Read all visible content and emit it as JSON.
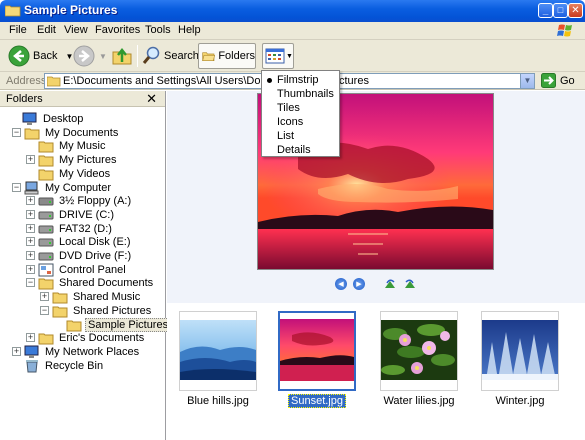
{
  "window": {
    "title": "Sample Pictures",
    "minimize": "_",
    "maximize": "□",
    "close": "✕"
  },
  "menu": [
    "File",
    "Edit",
    "View",
    "Favorites",
    "Tools",
    "Help"
  ],
  "toolbar": {
    "back": "Back",
    "search": "Search",
    "folders": "Folders"
  },
  "address": {
    "label": "Address",
    "path": "E:\\Documents and Settings\\All Users\\Documents\\My",
    "path_tail": "ctures",
    "go": "Go"
  },
  "views_menu": {
    "items": [
      "Filmstrip",
      "Thumbnails",
      "Tiles",
      "Icons",
      "List",
      "Details"
    ],
    "selected": "Filmstrip"
  },
  "folders_pane": {
    "title": "Folders",
    "close": "✕",
    "tree": [
      {
        "label": "Desktop",
        "icon": "desktop-icon",
        "toggle": ""
      },
      {
        "label": "My Documents",
        "icon": "my-documents-icon",
        "toggle": "−"
      },
      {
        "label": "My Music",
        "icon": "music-folder-icon",
        "toggle": ""
      },
      {
        "label": "My Pictures",
        "icon": "pictures-folder-icon",
        "toggle": "+"
      },
      {
        "label": "My Videos",
        "icon": "videos-folder-icon",
        "toggle": ""
      },
      {
        "label": "My Computer",
        "icon": "my-computer-icon",
        "toggle": "−"
      },
      {
        "label": "3½ Floppy (A:)",
        "icon": "floppy-icon",
        "toggle": "+"
      },
      {
        "label": "DRIVE (C:)",
        "icon": "drive-icon",
        "toggle": "+"
      },
      {
        "label": "FAT32 (D:)",
        "icon": "drive-icon",
        "toggle": "+"
      },
      {
        "label": "Local Disk (E:)",
        "icon": "drive-icon",
        "toggle": "+"
      },
      {
        "label": "DVD Drive (F:)",
        "icon": "dvd-drive-icon",
        "toggle": "+"
      },
      {
        "label": "Control Panel",
        "icon": "control-panel-icon",
        "toggle": "+"
      },
      {
        "label": "Shared Documents",
        "icon": "folder-open-icon",
        "toggle": "−"
      },
      {
        "label": "Shared Music",
        "icon": "music-folder-icon",
        "toggle": "+"
      },
      {
        "label": "Shared Pictures",
        "icon": "pictures-folder-icon",
        "toggle": "−"
      },
      {
        "label": "Sample Pictures",
        "icon": "folder-open-icon",
        "toggle": ""
      },
      {
        "label": "Eric's Documents",
        "icon": "folder-icon",
        "toggle": "+"
      },
      {
        "label": "My Network Places",
        "icon": "network-places-icon",
        "toggle": "+"
      },
      {
        "label": "Recycle Bin",
        "icon": "recycle-bin-icon",
        "toggle": ""
      }
    ],
    "selected": "Sample Pictures"
  },
  "filmstrip": {
    "items": [
      {
        "name": "Blue hills.jpg"
      },
      {
        "name": "Sunset.jpg"
      },
      {
        "name": "Water lilies.jpg"
      },
      {
        "name": "Winter.jpg"
      }
    ],
    "selected": "Sunset.jpg"
  },
  "colors": {
    "selection": "#316ac5",
    "titlebar": "#0453d6",
    "chrome": "#ece9d8"
  }
}
